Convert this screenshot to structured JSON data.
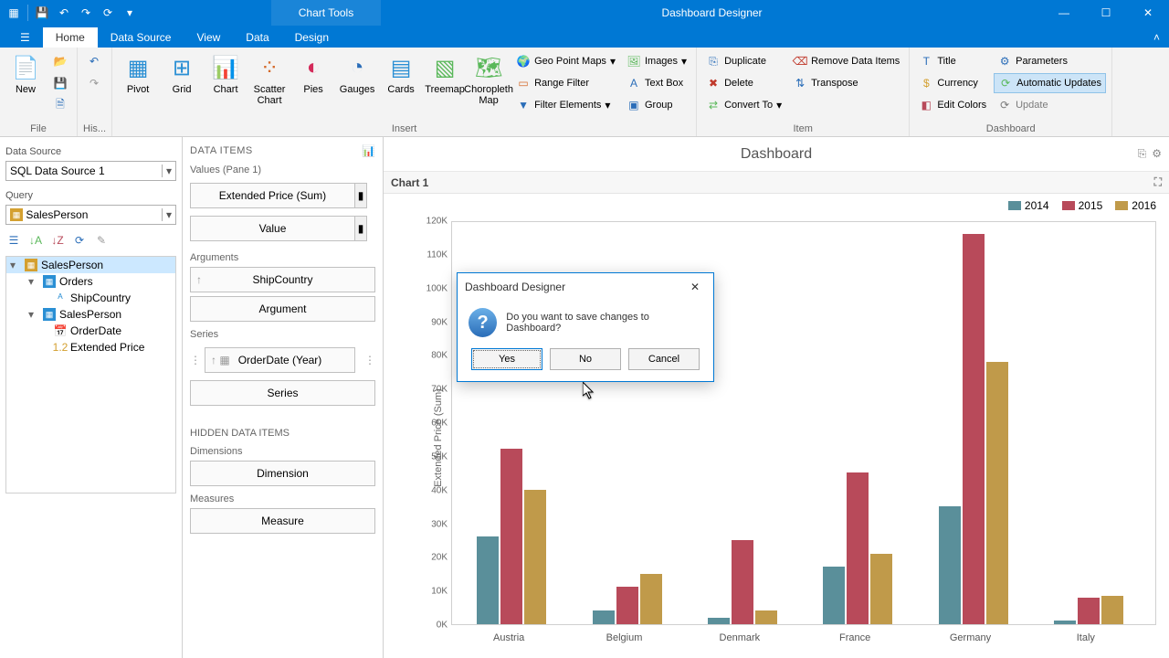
{
  "window": {
    "app_title": "Dashboard Designer",
    "chart_tools": "Chart Tools"
  },
  "tabs": {
    "file": "☰",
    "home": "Home",
    "data_source": "Data Source",
    "view": "View",
    "data": "Data",
    "design": "Design"
  },
  "ribbon": {
    "groups": {
      "file": "File",
      "history": "His...",
      "insert": "Insert",
      "item": "Item",
      "dashboard": "Dashboard"
    },
    "new": "New",
    "pivot": "Pivot",
    "grid": "Grid",
    "chart": "Chart",
    "scatter": "Scatter Chart",
    "pies": "Pies",
    "gauges": "Gauges",
    "cards": "Cards",
    "treemap": "Treemap",
    "choropleth": "Choropleth Map",
    "geopoint": "Geo Point Maps",
    "range_filter": "Range Filter",
    "filter_elements": "Filter Elements",
    "images": "Images",
    "text_box": "Text Box",
    "group": "Group",
    "duplicate": "Duplicate",
    "delete": "Delete",
    "convert_to": "Convert To",
    "remove_items": "Remove Data Items",
    "transpose": "Transpose",
    "title": "Title",
    "currency": "Currency",
    "edit_colors": "Edit Colors",
    "parameters": "Parameters",
    "auto_updates": "Automatic Updates",
    "update": "Update"
  },
  "sidebar": {
    "data_source_label": "Data Source",
    "data_source_value": "SQL Data Source 1",
    "query_label": "Query",
    "query_value": "SalesPerson",
    "tree": {
      "root": "SalesPerson",
      "orders": "Orders",
      "ship_country": "ShipCountry",
      "sales_person": "SalesPerson",
      "order_date": "OrderDate",
      "extended_price": "Extended Price"
    }
  },
  "dataitems": {
    "title": "DATA ITEMS",
    "values_header": "Values (Pane 1)",
    "value_pill_1": "Extended Price (Sum)",
    "value_pill_2": "Value",
    "arguments_header": "Arguments",
    "arg_pill_1": "ShipCountry",
    "arg_pill_2": "Argument",
    "series_header": "Series",
    "series_pill_1": "OrderDate (Year)",
    "series_pill_2": "Series",
    "hidden_header": "HIDDEN DATA ITEMS",
    "dimensions_header": "Dimensions",
    "dim_pill": "Dimension",
    "measures_header": "Measures",
    "measure_pill": "Measure"
  },
  "canvas": {
    "title": "Dashboard",
    "chart_title": "Chart 1"
  },
  "chart_data": {
    "type": "bar",
    "title": "Chart 1",
    "ylabel": "Extended Price (Sum)",
    "xlabel": "",
    "categories": [
      "Austria",
      "Belgium",
      "Denmark",
      "France",
      "Germany",
      "Italy"
    ],
    "series": [
      {
        "name": "2014",
        "color": "#5a8f9a",
        "values": [
          26000,
          4000,
          2000,
          17000,
          35000,
          1000
        ]
      },
      {
        "name": "2015",
        "color": "#b84a5a",
        "values": [
          52000,
          11000,
          25000,
          45000,
          116000,
          8000
        ]
      },
      {
        "name": "2016",
        "color": "#c09a4a",
        "values": [
          40000,
          15000,
          4000,
          21000,
          78000,
          8500
        ]
      }
    ],
    "ylim": [
      0,
      120000
    ],
    "yticks": [
      "0K",
      "10K",
      "20K",
      "30K",
      "40K",
      "50K",
      "60K",
      "70K",
      "80K",
      "90K",
      "100K",
      "110K",
      "120K"
    ]
  },
  "dialog": {
    "title": "Dashboard Designer",
    "message": "Do you want to save changes to Dashboard?",
    "yes": "Yes",
    "no": "No",
    "cancel": "Cancel"
  }
}
